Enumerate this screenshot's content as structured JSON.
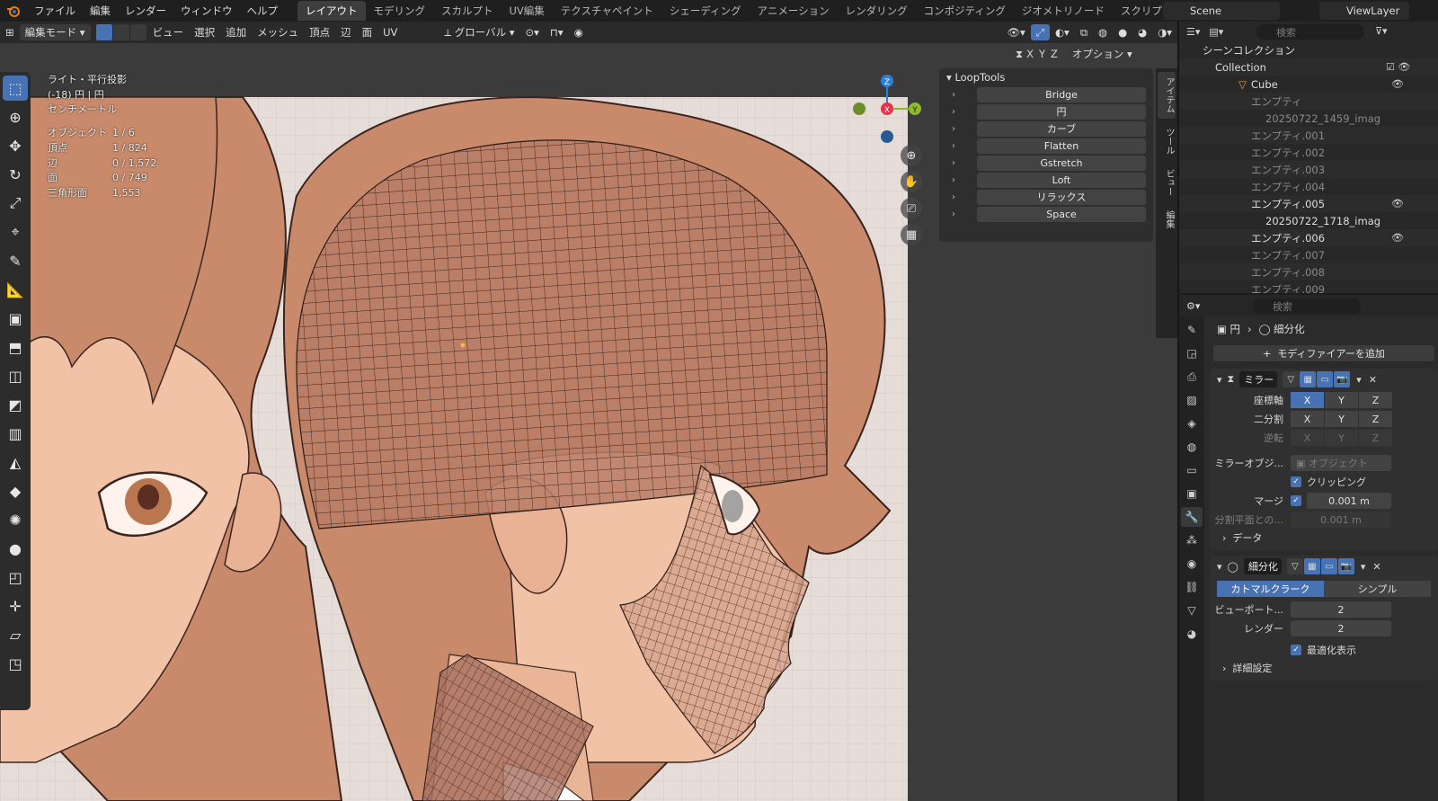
{
  "menubar": {
    "items": [
      "ファイル",
      "編集",
      "レンダー",
      "ウィンドウ",
      "ヘルプ"
    ],
    "workspaces": [
      "レイアウト",
      "モデリング",
      "スカルプト",
      "UV編集",
      "テクスチャペイント",
      "シェーディング",
      "アニメーション",
      "レンダリング",
      "コンポジティング",
      "ジオメトリノード",
      "スクリプト作成"
    ],
    "active_workspace": "レイアウト",
    "scene": "Scene",
    "view_layer": "ViewLayer"
  },
  "viewport_header": {
    "mode": "編集モード",
    "menus": [
      "ビュー",
      "選択",
      "追加",
      "メッシュ",
      "頂点",
      "辺",
      "面",
      "UV"
    ],
    "transform_orientation": "グローバル",
    "mirror_axes": [
      "X",
      "Y",
      "Z"
    ],
    "options_label": "オプション"
  },
  "viewport_overlay": {
    "view_name": "ライト・平行投影",
    "collection_line": "(-18) 円 | 円",
    "units": "センチメートル",
    "stats": [
      {
        "label": "オブジェクト",
        "value": "1 / 6"
      },
      {
        "label": "頂点",
        "value": "1 / 824"
      },
      {
        "label": "辺",
        "value": "0 / 1,572"
      },
      {
        "label": "面",
        "value": "0 / 749"
      },
      {
        "label": "三角形面",
        "value": "1,553"
      }
    ]
  },
  "gizmo": {
    "x": "X",
    "y": "Y",
    "z": "Z",
    "x_color": "#e8324a",
    "y_color": "#8db92c",
    "z_color": "#2e7fd4"
  },
  "looptools": {
    "title": "LoopTools",
    "buttons": [
      "Bridge",
      "円",
      "カーブ",
      "Flatten",
      "Gstretch",
      "Loft",
      "リラックス",
      "Space"
    ]
  },
  "npanel_tabs": [
    "アイテム",
    "ツール",
    "ビュー",
    "編集"
  ],
  "outliner": {
    "search_placeholder": "検索",
    "root": "シーンコレクション",
    "collection": "Collection",
    "rows": [
      {
        "name": "Cube",
        "indent": 2
      },
      {
        "name": "エンプティ",
        "indent": 2,
        "dim": true
      },
      {
        "name": "20250722_1459_imag",
        "indent": 3,
        "dim": true
      },
      {
        "name": "エンプティ.001",
        "indent": 2,
        "dim": true
      },
      {
        "name": "エンプティ.002",
        "indent": 2,
        "dim": true
      },
      {
        "name": "エンプティ.003",
        "indent": 2,
        "dim": true
      },
      {
        "name": "エンプティ.004",
        "indent": 2,
        "dim": true
      },
      {
        "name": "エンプティ.005",
        "indent": 2
      },
      {
        "name": "20250722_1718_imag",
        "indent": 3
      },
      {
        "name": "エンプティ.006",
        "indent": 2
      },
      {
        "name": "エンプティ.007",
        "indent": 2,
        "dim": true
      },
      {
        "name": "エンプティ.008",
        "indent": 2,
        "dim": true
      },
      {
        "name": "エンプティ.009",
        "indent": 2,
        "dim": true
      }
    ]
  },
  "properties": {
    "search_placeholder": "検索",
    "object_name": "円",
    "modifier_context": "細分化",
    "add_modifier": "モディファイアーを追加",
    "mirror": {
      "name": "ミラー",
      "axis_label": "座標軸",
      "bisect_label": "二分割",
      "flip_label": "逆転",
      "mirror_object_label": "ミラーオブジ...",
      "object_placeholder": "オブジェクト",
      "clipping_label": "クリッピング",
      "merge_label": "マージ",
      "merge_value": "0.001 m",
      "bisect_distance_label": "分割平面との...",
      "bisect_distance_value": "0.001 m",
      "data_label": "データ"
    },
    "subdiv": {
      "name": "細分化",
      "type_a": "カトマルクラーク",
      "type_b": "シンプル",
      "viewport_label": "ビューポート...",
      "viewport_value": "2",
      "render_label": "レンダー",
      "render_value": "2",
      "optimal_label": "最適化表示",
      "advanced_label": "詳細設定"
    }
  },
  "colors": {
    "accent": "#4772b3",
    "skin": "#f1c2a6",
    "hair": "#c88a6a",
    "outline": "#3a2420",
    "backdrop": "#e6dcd8"
  }
}
